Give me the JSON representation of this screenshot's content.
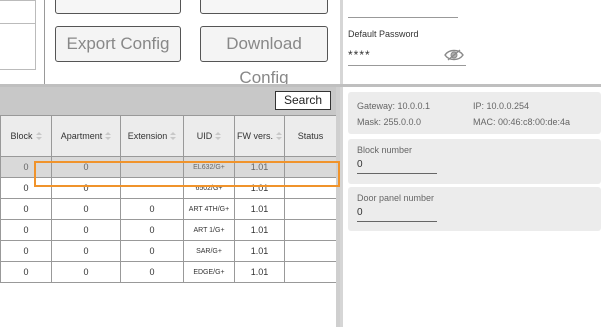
{
  "toolbar": {
    "export_config_label": "Export Config",
    "download_config_label": "Download Config"
  },
  "password": {
    "label": "Default Password",
    "value": "****",
    "visibility_icon": "eye-icon"
  },
  "table": {
    "search_label": "Search",
    "columns": [
      "Block",
      "Apartment",
      "Extension",
      "UID",
      "FW vers.",
      "Status"
    ],
    "rows": [
      {
        "block": "0",
        "apartment": "0",
        "extension": "",
        "uid": "EL632/G+",
        "fw": "1.01",
        "status": "",
        "selected": true
      },
      {
        "block": "0",
        "apartment": "0",
        "extension": "",
        "uid": "6502/G+",
        "fw": "1.01",
        "status": ""
      },
      {
        "block": "0",
        "apartment": "0",
        "extension": "0",
        "uid": "ART 4TH/G+",
        "fw": "1.01",
        "status": ""
      },
      {
        "block": "0",
        "apartment": "0",
        "extension": "0",
        "uid": "ART 1/G+",
        "fw": "1.01",
        "status": ""
      },
      {
        "block": "0",
        "apartment": "0",
        "extension": "0",
        "uid": "SAR/G+",
        "fw": "1.01",
        "status": ""
      },
      {
        "block": "0",
        "apartment": "0",
        "extension": "0",
        "uid": "EDGE/G+",
        "fw": "1.01",
        "status": ""
      }
    ]
  },
  "network": {
    "gateway": "Gateway:  10.0.0.1",
    "ip": "IP:  10.0.0.254",
    "mask": "Mask:  255.0.0.0",
    "mac": "MAC:  00:46:c8:00:de:4a"
  },
  "block_number": {
    "label": "Block number",
    "value": "0"
  },
  "door_panel_number": {
    "label": "Door panel number",
    "value": "0"
  },
  "colors": {
    "highlight": "#f0932b",
    "toolbar_bg": "#c8c8c8",
    "card_bg": "#ececec"
  }
}
